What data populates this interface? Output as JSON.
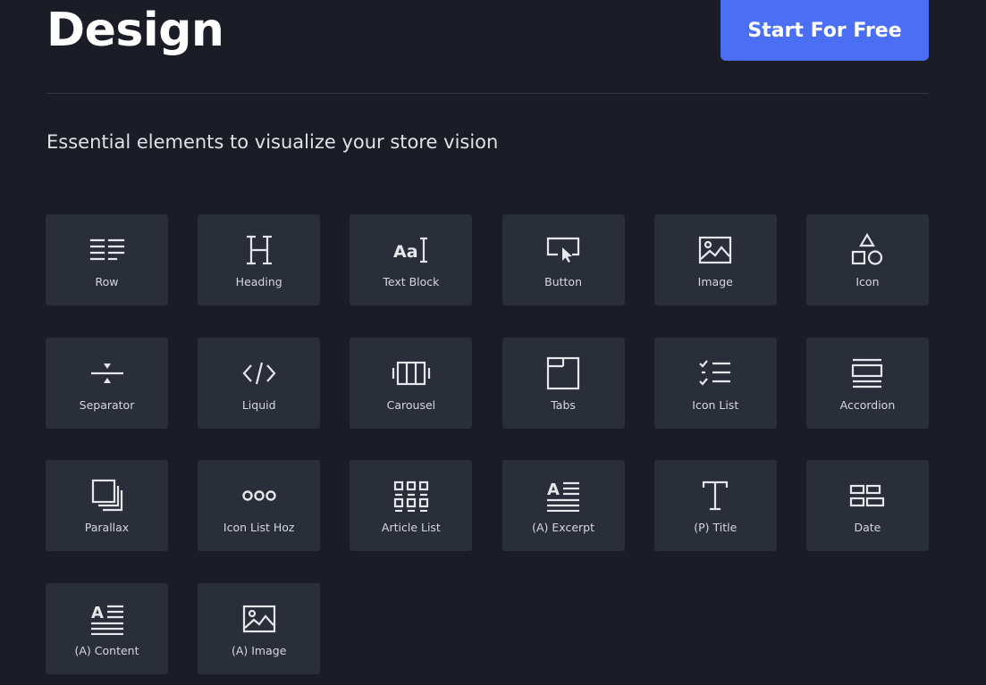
{
  "header": {
    "title": "Design",
    "cta_label": "Start For Free",
    "subtitle": "Essential elements to visualize your store vision"
  },
  "colors": {
    "background": "#1a1d26",
    "tile": "#2a2e39",
    "accent": "#4a6ff5",
    "divider": "#343846"
  },
  "elements": [
    {
      "label": "Row",
      "icon": "row-icon"
    },
    {
      "label": "Heading",
      "icon": "heading-icon"
    },
    {
      "label": "Text Block",
      "icon": "text-block-icon"
    },
    {
      "label": "Button",
      "icon": "button-icon"
    },
    {
      "label": "Image",
      "icon": "image-icon"
    },
    {
      "label": "Icon",
      "icon": "shapes-icon"
    },
    {
      "label": "Separator",
      "icon": "separator-icon"
    },
    {
      "label": "Liquid",
      "icon": "code-icon"
    },
    {
      "label": "Carousel",
      "icon": "carousel-icon"
    },
    {
      "label": "Tabs",
      "icon": "tabs-icon"
    },
    {
      "label": "Icon List",
      "icon": "checklist-icon"
    },
    {
      "label": "Accordion",
      "icon": "accordion-icon"
    },
    {
      "label": "Parallax",
      "icon": "parallax-icon"
    },
    {
      "label": "Icon List Hoz",
      "icon": "horizontal-dots-icon"
    },
    {
      "label": "Article List",
      "icon": "article-grid-icon"
    },
    {
      "label": "(A) Excerpt",
      "icon": "excerpt-icon"
    },
    {
      "label": "(P) Title",
      "icon": "title-icon"
    },
    {
      "label": "Date",
      "icon": "date-icon"
    },
    {
      "label": "(A) Content",
      "icon": "content-icon"
    },
    {
      "label": "(A) Image",
      "icon": "article-image-icon"
    }
  ]
}
